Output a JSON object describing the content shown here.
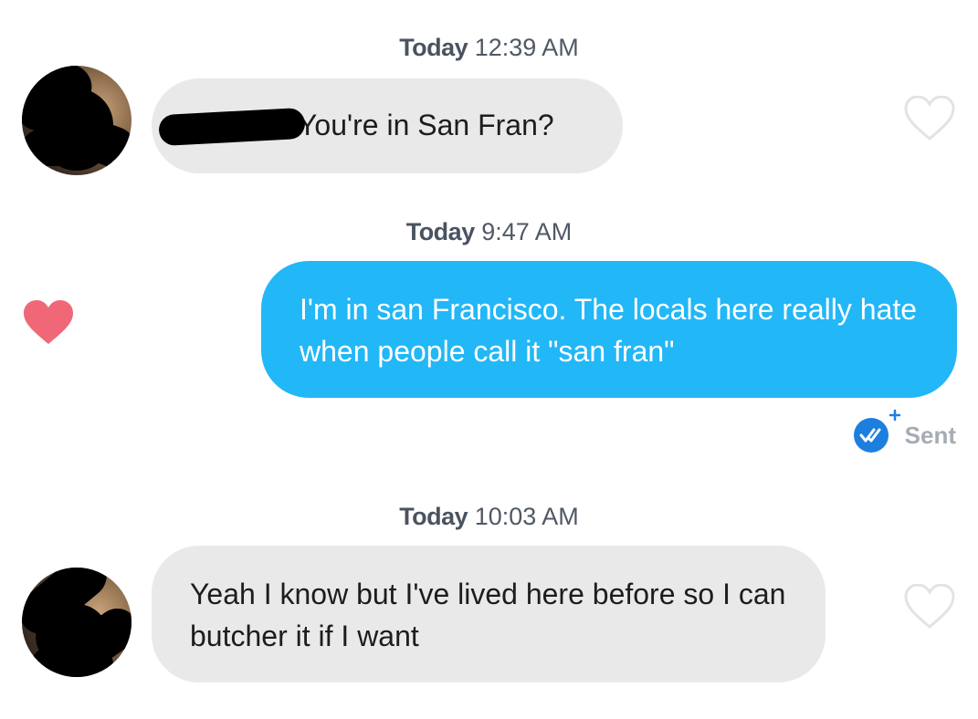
{
  "messages": [
    {
      "timestamp": {
        "day": "Today",
        "time": "12:39 AM"
      },
      "text": "You're in San Fran?",
      "direction": "received",
      "liked": false
    },
    {
      "timestamp": {
        "day": "Today",
        "time": "9:47 AM"
      },
      "text": "I'm in san Francisco. The locals here really hate when people call it \"san fran\"",
      "direction": "sent",
      "liked": true,
      "status": "Sent"
    },
    {
      "timestamp": {
        "day": "Today",
        "time": "10:03 AM"
      },
      "text": "Yeah I know but I've lived here before so I can butcher it if I want",
      "direction": "received",
      "liked": false
    }
  ],
  "colors": {
    "sent_bubble": "#22b7f7",
    "received_bubble": "#e9e9ea",
    "like_heart": "#f06878",
    "read_receipt": "#1c7fe0"
  },
  "icons": {
    "unliked": "heart-outline-icon",
    "liked": "heart-filled-icon",
    "read_receipt": "double-check-icon"
  }
}
